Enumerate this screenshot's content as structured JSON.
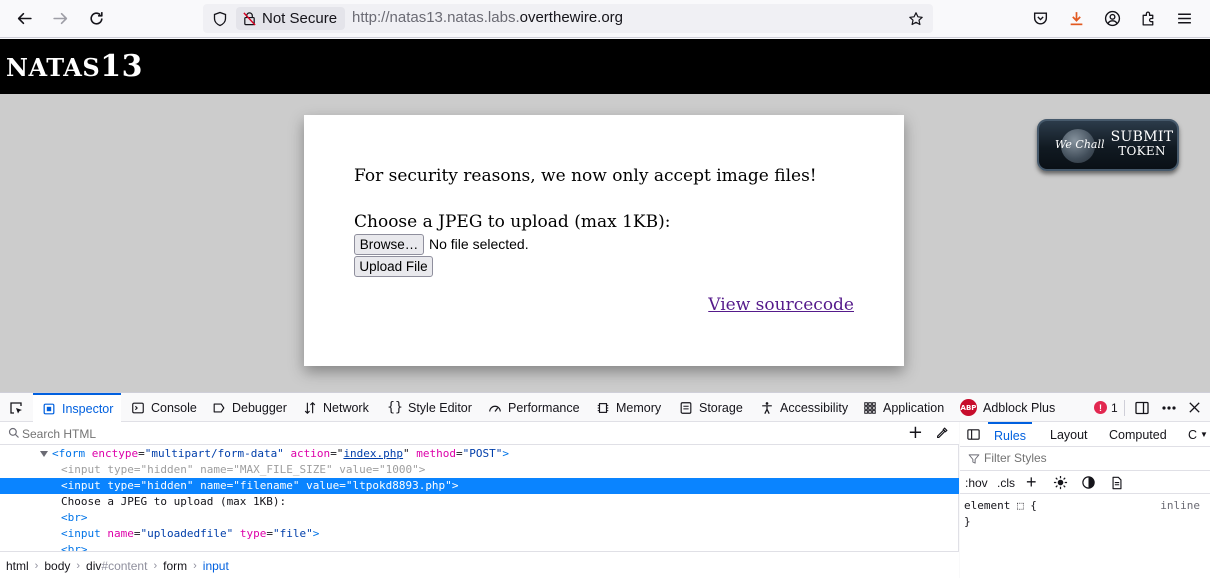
{
  "browser": {
    "security_label": "Not Secure",
    "url_prefix": "http://natas13.natas.labs.",
    "url_domain": "overthewire.org"
  },
  "page": {
    "title_prefix": "NATAS",
    "title_number": "13",
    "message": "For security reasons, we now only accept image files!",
    "upload_prompt": "Choose a JPEG to upload (max 1KB):",
    "browse_label": "Browse…",
    "no_file_text": "No file selected.",
    "upload_label": "Upload File",
    "view_source_label": "View sourcecode",
    "wechall": {
      "brand": "We Chall",
      "label_line1": "SUBMIT",
      "label_line2": "TOKEN"
    }
  },
  "devtools": {
    "tabs": [
      {
        "label": "Inspector",
        "icon": "inspector-icon"
      },
      {
        "label": "Console",
        "icon": "console-icon"
      },
      {
        "label": "Debugger",
        "icon": "debugger-icon"
      },
      {
        "label": "Network",
        "icon": "network-icon"
      },
      {
        "label": "Style Editor",
        "icon": "style-editor-icon"
      },
      {
        "label": "Performance",
        "icon": "performance-icon"
      },
      {
        "label": "Memory",
        "icon": "memory-icon"
      },
      {
        "label": "Storage",
        "icon": "storage-icon"
      },
      {
        "label": "Accessibility",
        "icon": "accessibility-icon"
      },
      {
        "label": "Application",
        "icon": "application-icon"
      },
      {
        "label": "Adblock Plus",
        "icon": "adblock-plus-icon"
      }
    ],
    "error_count": "1",
    "search_placeholder": "Search HTML",
    "markup": {
      "form_tag": "form",
      "form_attr1_name": "enctype",
      "form_attr1_value": "\"multipart/form-data\"",
      "form_attr2_name": "action",
      "form_attr2_value": "index.php",
      "form_attr3_name": "method",
      "form_attr3_value": "\"POST\"",
      "input_tag": "input",
      "type_attr": "type",
      "name_attr": "name",
      "value_attr": "value",
      "hidden_value": "\"hidden\"",
      "maxsize_name": "\"MAX_FILE_SIZE\"",
      "maxsize_value": "\"1000\"",
      "filename_name": "\"filename\"",
      "filename_value": "\"ltpokd8893.php\"",
      "text_node": "Choose a JPEG to upload (max 1KB):",
      "br_tag": "<br>",
      "uploaded_name": "\"uploadedfile\"",
      "file_value": "\"file\""
    },
    "breadcrumbs": [
      "html",
      "body",
      "div",
      "#content",
      "form",
      "input"
    ],
    "rules_tabs": [
      "Rules",
      "Layout",
      "Computed",
      "C"
    ],
    "filter_placeholder": "Filter Styles",
    "hov_label": ":hov",
    "cls_label": ".cls",
    "element_rule": "element ⬚ {",
    "element_rule_close": "}",
    "inline_label": "inline"
  }
}
